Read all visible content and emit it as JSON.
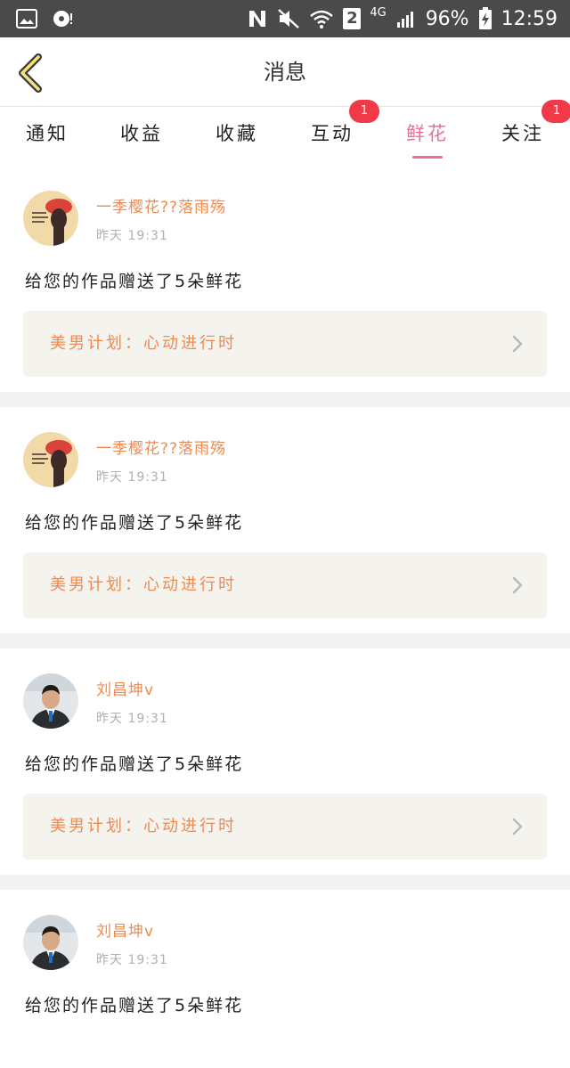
{
  "status_bar": {
    "battery": "96%",
    "time": "12:59",
    "sim_slot": "2",
    "network": "4G",
    "icons": [
      "gallery-icon",
      "record-icon",
      "nfc-icon",
      "mute-icon",
      "wifi-icon",
      "signal-icon",
      "battery-charging-icon"
    ]
  },
  "header": {
    "title": "消息"
  },
  "tabs": [
    {
      "label": "通知",
      "badge": ""
    },
    {
      "label": "收益",
      "badge": ""
    },
    {
      "label": "收藏",
      "badge": ""
    },
    {
      "label": "互动",
      "badge": "1"
    },
    {
      "label": "鲜花",
      "badge": "",
      "active": true
    },
    {
      "label": "关注",
      "badge": "1"
    }
  ],
  "messages": [
    {
      "sender": "一季樱花??落雨殇",
      "time": "昨天  19:31",
      "text": "给您的作品赠送了5朵鲜花",
      "work_title": "美男计划：心动进行时",
      "avatar": "cartoon-girl"
    },
    {
      "sender": "一季樱花??落雨殇",
      "time": "昨天  19:31",
      "text": "给您的作品赠送了5朵鲜花",
      "work_title": "美男计划：心动进行时",
      "avatar": "cartoon-girl"
    },
    {
      "sender": "刘昌坤v",
      "time": "昨天  19:31",
      "text": "给您的作品赠送了5朵鲜花",
      "work_title": "美男计划：心动进行时",
      "avatar": "man-photo"
    },
    {
      "sender": "刘昌坤v",
      "time": "昨天  19:31",
      "text": "给您的作品赠送了5朵鲜花",
      "avatar": "man-photo"
    }
  ],
  "colors": {
    "accent_pink": "#ec6e97",
    "orange_text": "#ef8a50",
    "badge_red": "#f2394a"
  }
}
